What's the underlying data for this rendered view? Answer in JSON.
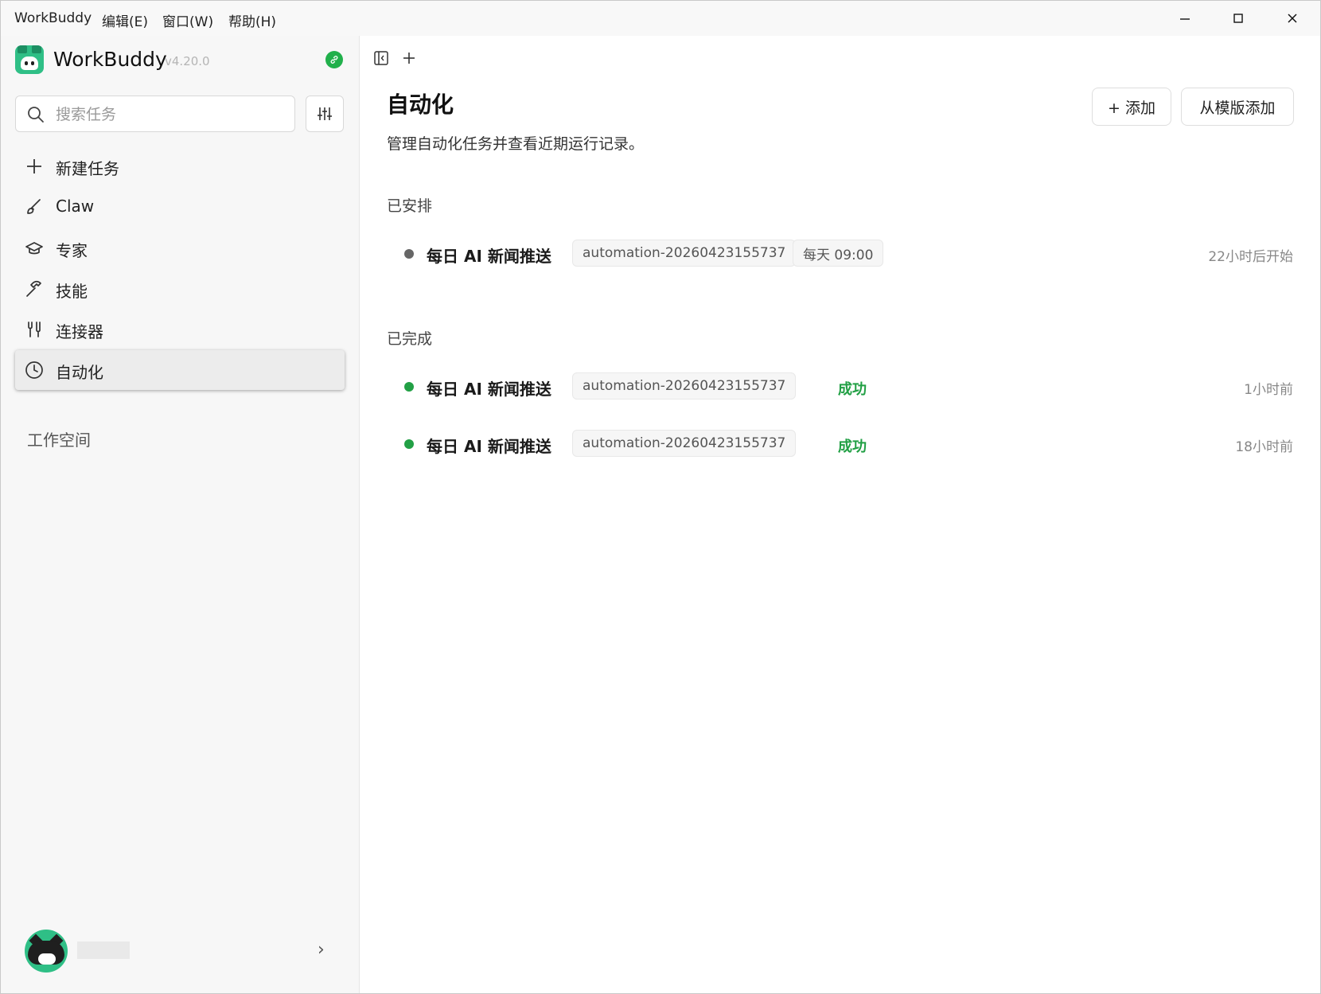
{
  "menubar": {
    "app": "WorkBuddy",
    "edit": "编辑(E)",
    "window": "窗口(W)",
    "help": "帮助(H)",
    "minimize": "—",
    "maximize": "☐",
    "close": "✕"
  },
  "sidebar": {
    "app_name": "WorkBuddy",
    "version": "v4.20.0",
    "search_placeholder": "搜索任务",
    "items": [
      {
        "label": "新建任务",
        "icon": "plus-icon"
      },
      {
        "label": "Claw",
        "icon": "brush-icon"
      },
      {
        "label": "专家",
        "icon": "graduation-cap-icon"
      },
      {
        "label": "技能",
        "icon": "hammer-icon"
      },
      {
        "label": "连接器",
        "icon": "connector-icon"
      },
      {
        "label": "自动化",
        "icon": "clock-icon"
      }
    ],
    "active_item": "自动化",
    "workspace_label": "工作空间",
    "user_chevron": "›"
  },
  "main": {
    "title": "自动化",
    "subtitle": "管理自动化任务并查看近期运行记录。",
    "add_button": "+ 添加",
    "template_button": "从模版添加",
    "scheduled_title": "已安排",
    "scheduled": [
      {
        "name": "每日 AI 新闻推送",
        "id": "automation-20260423155737",
        "schedule": "每天 09:00",
        "time": "22小时后开始"
      }
    ],
    "completed_title": "已完成",
    "completed": [
      {
        "name": "每日 AI 新闻推送",
        "id": "automation-20260423155737",
        "status": "成功",
        "time": "1小时前"
      },
      {
        "name": "每日 AI 新闻推送",
        "id": "automation-20260423155737",
        "status": "成功",
        "time": "18小时前"
      }
    ]
  },
  "colors": {
    "accent_green": "#2fbf86",
    "success": "#22a045",
    "scheduled_dot": "#666666"
  }
}
